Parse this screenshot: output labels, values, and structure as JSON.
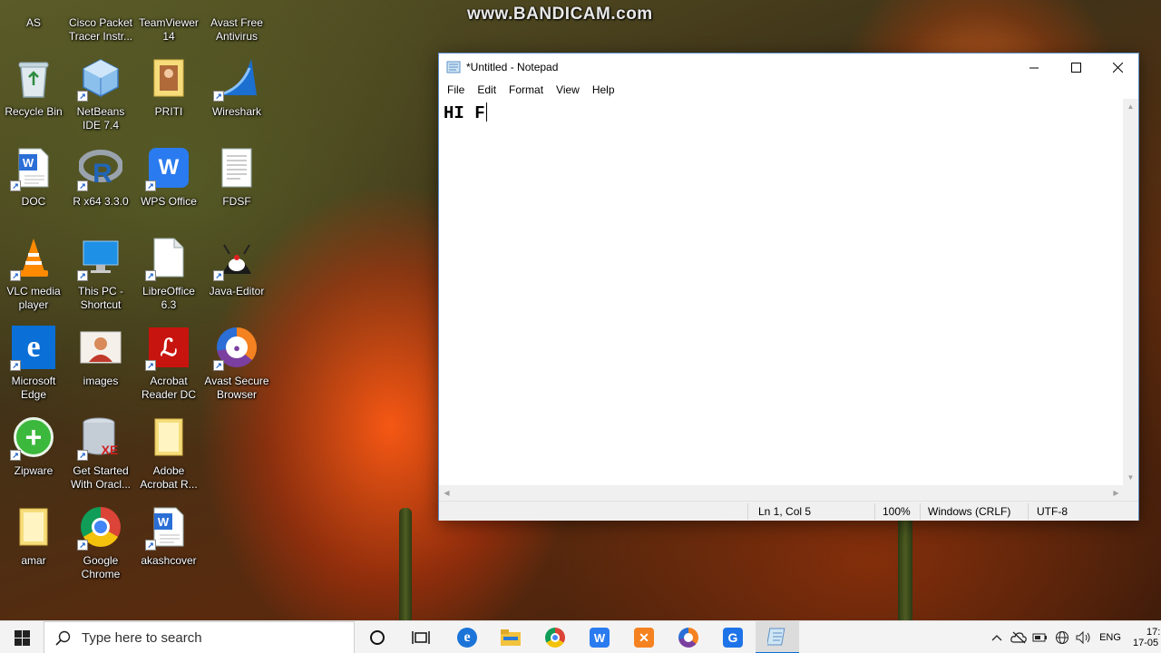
{
  "watermark": "www.BANDICAM.com",
  "desktop_icons": {
    "as": "AS",
    "cisco": "Cisco Packet Tracer Instr...",
    "teamviewer": "TeamViewer 14",
    "avast_free": "Avast Free Antivirus",
    "recycle_bin": "Recycle Bin",
    "netbeans": "NetBeans IDE 7.4",
    "priti": "PRITI",
    "wireshark": "Wireshark",
    "doc": "DOC",
    "r_x64": "R x64 3.3.0",
    "wps_office": "WPS Office",
    "fdsf": "FDSF",
    "vlc": "VLC media player",
    "this_pc": "This PC - Shortcut",
    "libreoffice": "LibreOffice 6.3",
    "java_editor": "Java-Editor",
    "edge": "Microsoft Edge",
    "images": "images",
    "acrobat": "Acrobat Reader DC",
    "avast_browser": "Avast Secure Browser",
    "zipware": "Zipware",
    "get_started": "Get Started With Oracl...",
    "adobe_acrobat": "Adobe Acrobat R...",
    "amar": "amar",
    "chrome": "Google Chrome",
    "akashcover": "akashcover"
  },
  "notepad": {
    "title": "*Untitled - Notepad",
    "menu": [
      "File",
      "Edit",
      "Format",
      "View",
      "Help"
    ],
    "content": "HI F",
    "status": {
      "position": "Ln 1, Col 5",
      "zoom": "100%",
      "line_ending": "Windows (CRLF)",
      "encoding": "UTF-8"
    }
  },
  "taskbar": {
    "search_placeholder": "Type here to search",
    "language": "ENG",
    "time": "17:",
    "date": "17-05"
  }
}
